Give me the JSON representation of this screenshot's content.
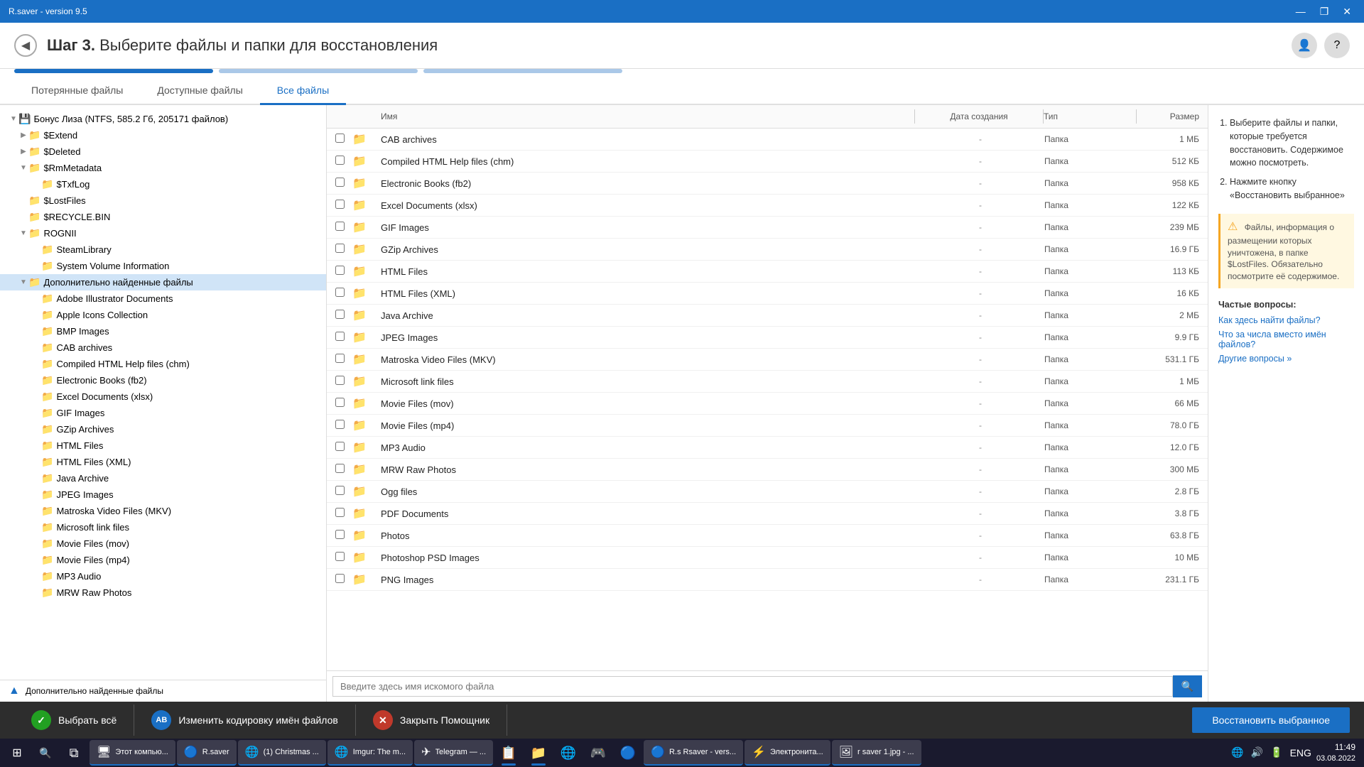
{
  "titlebar": {
    "title": "R.saver - version 9.5",
    "minimize": "—",
    "restore": "❐",
    "close": "✕"
  },
  "header": {
    "step": "Шаг 3.",
    "subtitle": "Выберите файлы и папки для восстановления"
  },
  "tabs": [
    {
      "label": "Потерянные файлы",
      "active": false
    },
    {
      "label": "Доступные файлы",
      "active": false
    },
    {
      "label": "Все файлы",
      "active": true
    }
  ],
  "tree": {
    "root_label": "Бонус Лиза (NTFS, 585.2 Гб, 205171 файлов)",
    "items": [
      {
        "label": "$Extend",
        "indent": 1,
        "type": "folder"
      },
      {
        "label": "$Deleted",
        "indent": 1,
        "type": "folder"
      },
      {
        "label": "$RmMetadata",
        "indent": 1,
        "type": "folder"
      },
      {
        "label": "$TxfLog",
        "indent": 2,
        "type": "folder"
      },
      {
        "label": "$LostFiles",
        "indent": 1,
        "type": "folder"
      },
      {
        "label": "$RECYCLE.BIN",
        "indent": 1,
        "type": "folder"
      },
      {
        "label": "ROGNII",
        "indent": 1,
        "type": "folder"
      },
      {
        "label": "SteamLibrary",
        "indent": 2,
        "type": "folder"
      },
      {
        "label": "System Volume Information",
        "indent": 2,
        "type": "folder"
      },
      {
        "label": "Дополнительно найденные файлы",
        "indent": 1,
        "type": "special",
        "selected": true
      },
      {
        "label": "Adobe Illustrator Documents",
        "indent": 2,
        "type": "folder"
      },
      {
        "label": "Apple Icons Collection",
        "indent": 2,
        "type": "folder"
      },
      {
        "label": "BMP Images",
        "indent": 2,
        "type": "folder"
      },
      {
        "label": "CAB archives",
        "indent": 2,
        "type": "folder"
      },
      {
        "label": "Compiled HTML Help files (chm)",
        "indent": 2,
        "type": "folder"
      },
      {
        "label": "Electronic Books (fb2)",
        "indent": 2,
        "type": "folder"
      },
      {
        "label": "Excel Documents (xlsx)",
        "indent": 2,
        "type": "folder"
      },
      {
        "label": "GIF Images",
        "indent": 2,
        "type": "folder"
      },
      {
        "label": "GZip Archives",
        "indent": 2,
        "type": "folder"
      },
      {
        "label": "HTML Files",
        "indent": 2,
        "type": "folder"
      },
      {
        "label": "HTML Files (XML)",
        "indent": 2,
        "type": "folder"
      },
      {
        "label": "Java Archive",
        "indent": 2,
        "type": "folder"
      },
      {
        "label": "JPEG Images",
        "indent": 2,
        "type": "folder"
      },
      {
        "label": "Matroska Video Files (MKV)",
        "indent": 2,
        "type": "folder"
      },
      {
        "label": "Microsoft link files",
        "indent": 2,
        "type": "folder"
      },
      {
        "label": "Movie Files (mov)",
        "indent": 2,
        "type": "folder"
      },
      {
        "label": "Movie Files (mp4)",
        "indent": 2,
        "type": "folder"
      },
      {
        "label": "MP3 Audio",
        "indent": 2,
        "type": "folder"
      },
      {
        "label": "MRW Raw Photos",
        "indent": 2,
        "type": "folder"
      }
    ]
  },
  "left_panel_footer": "Дополнительно найденные файлы",
  "file_list": {
    "headers": {
      "name": "Имя",
      "date": "Дата создания",
      "type": "Тип",
      "size": "Размер"
    },
    "rows": [
      {
        "name": "CAB archives",
        "date": "-",
        "type": "Папка",
        "size": "1 МБ"
      },
      {
        "name": "Compiled HTML Help files (chm)",
        "date": "-",
        "type": "Папка",
        "size": "512 КБ"
      },
      {
        "name": "Electronic Books (fb2)",
        "date": "-",
        "type": "Папка",
        "size": "958 КБ"
      },
      {
        "name": "Excel Documents (xlsx)",
        "date": "-",
        "type": "Папка",
        "size": "122 КБ"
      },
      {
        "name": "GIF Images",
        "date": "-",
        "type": "Папка",
        "size": "239 МБ"
      },
      {
        "name": "GZip Archives",
        "date": "-",
        "type": "Папка",
        "size": "16.9 ГБ"
      },
      {
        "name": "HTML Files",
        "date": "-",
        "type": "Папка",
        "size": "113 КБ"
      },
      {
        "name": "HTML Files (XML)",
        "date": "-",
        "type": "Папка",
        "size": "16 КБ"
      },
      {
        "name": "Java Archive",
        "date": "-",
        "type": "Папка",
        "size": "2 МБ"
      },
      {
        "name": "JPEG Images",
        "date": "-",
        "type": "Папка",
        "size": "9.9 ГБ"
      },
      {
        "name": "Matroska Video Files (MKV)",
        "date": "-",
        "type": "Папка",
        "size": "531.1 ГБ"
      },
      {
        "name": "Microsoft link files",
        "date": "-",
        "type": "Папка",
        "size": "1 МБ"
      },
      {
        "name": "Movie Files (mov)",
        "date": "-",
        "type": "Папка",
        "size": "66 МБ"
      },
      {
        "name": "Movie Files (mp4)",
        "date": "-",
        "type": "Папка",
        "size": "78.0 ГБ"
      },
      {
        "name": "MP3 Audio",
        "date": "-",
        "type": "Папка",
        "size": "12.0 ГБ"
      },
      {
        "name": "MRW Raw Photos",
        "date": "-",
        "type": "Папка",
        "size": "300 МБ"
      },
      {
        "name": "Ogg files",
        "date": "-",
        "type": "Папка",
        "size": "2.8 ГБ"
      },
      {
        "name": "PDF Documents",
        "date": "-",
        "type": "Папка",
        "size": "3.8 ГБ"
      },
      {
        "name": "Photos",
        "date": "-",
        "type": "Папка",
        "size": "63.8 ГБ"
      },
      {
        "name": "Photoshop PSD Images",
        "date": "-",
        "type": "Папка",
        "size": "10 МБ"
      },
      {
        "name": "PNG Images",
        "date": "-",
        "type": "Папка",
        "size": "231.1 ГБ"
      }
    ]
  },
  "search": {
    "placeholder": "Введите здесь имя искомого файла"
  },
  "info_panel": {
    "steps": [
      "Выберите файлы и папки, которые требуется восстановить. Содержимое можно посмотреть.",
      "Нажмите кнопку «Восстановить выбранное»"
    ],
    "warning": "Файлы, информация о размещении которых уничтожена, в папке $LostFiles. Обязательно посмотрите её содержимое.",
    "faq_title": "Частые вопросы:",
    "faq_items": [
      "Как здесь найти файлы?",
      "Что за числа вместо имён файлов?",
      "Другие вопросы »"
    ]
  },
  "toolbar": {
    "select_all": "Выбрать всё",
    "change_encoding": "Изменить кодировку имён файлов",
    "close_assistant": "Закрыть Помощник",
    "restore": "Восстановить выбранное"
  },
  "taskbar": {
    "time": "11:49",
    "date": "03.08.2022",
    "lang": "ENG",
    "apps": [
      {
        "label": "Этот компью...",
        "icon": "🖥"
      },
      {
        "label": "R.saver",
        "icon": "🔵"
      },
      {
        "label": "(1) Christmas ...",
        "icon": "🌐"
      },
      {
        "label": "Imgur: The m...",
        "icon": "🌐"
      },
      {
        "label": "Telegram — ...",
        "icon": "✈"
      },
      {
        "label": "",
        "icon": "📋"
      },
      {
        "label": "",
        "icon": "📁"
      },
      {
        "label": "",
        "icon": "🌐"
      },
      {
        "label": "",
        "icon": "🎮"
      },
      {
        "label": "",
        "icon": "🔵"
      },
      {
        "label": "R.s Rsaver - vers...",
        "icon": "🔵"
      },
      {
        "label": "Электронита...",
        "icon": "⚡"
      },
      {
        "label": "r saver 1.jpg - ...",
        "icon": "🖼"
      }
    ]
  }
}
